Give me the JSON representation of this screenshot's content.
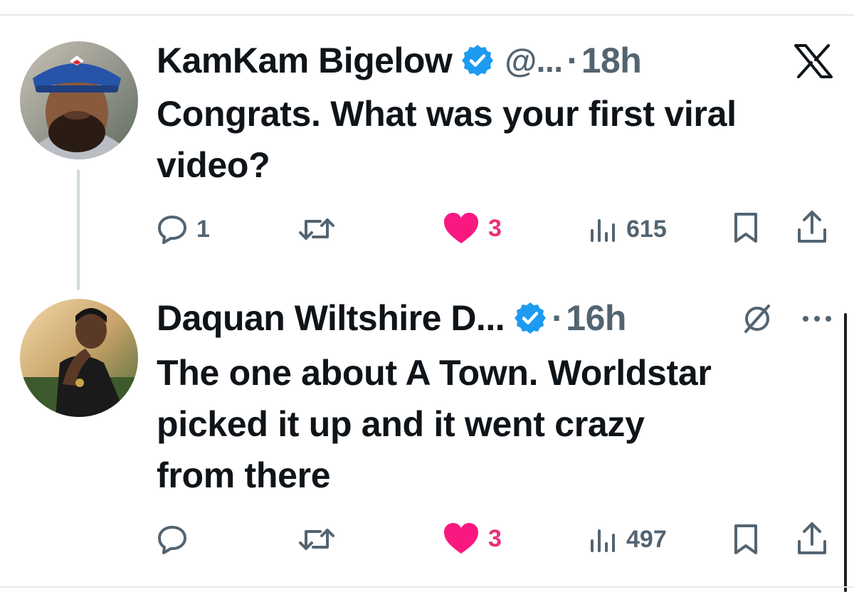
{
  "thread": {
    "tweets": [
      {
        "display_name": "KamKam Bigelow",
        "handle": "@...",
        "separator": "·",
        "timestamp": "18h",
        "text_lines": [
          "Congrats. What was your first viral",
          "video?"
        ],
        "replies": "1",
        "retweets": "",
        "likes": "3",
        "views": "615",
        "corner_icon": "x-logo-icon",
        "liked": true
      },
      {
        "display_name": "Daquan Wiltshire D...",
        "handle": "",
        "separator": "·",
        "timestamp": "16h",
        "text_lines": [
          "The one about A Town. Worldstar",
          "picked it up and it went crazy",
          "from there"
        ],
        "replies": "",
        "retweets": "",
        "likes": "3",
        "views": "497",
        "corner_icon": "grok-icon",
        "more_icon": "more-options-icon",
        "liked": true
      }
    ]
  },
  "colors": {
    "verified_blue": "#1d9bf0",
    "like_pink": "#f91880",
    "secondary_text": "#536471",
    "primary_text": "#0f1419"
  }
}
